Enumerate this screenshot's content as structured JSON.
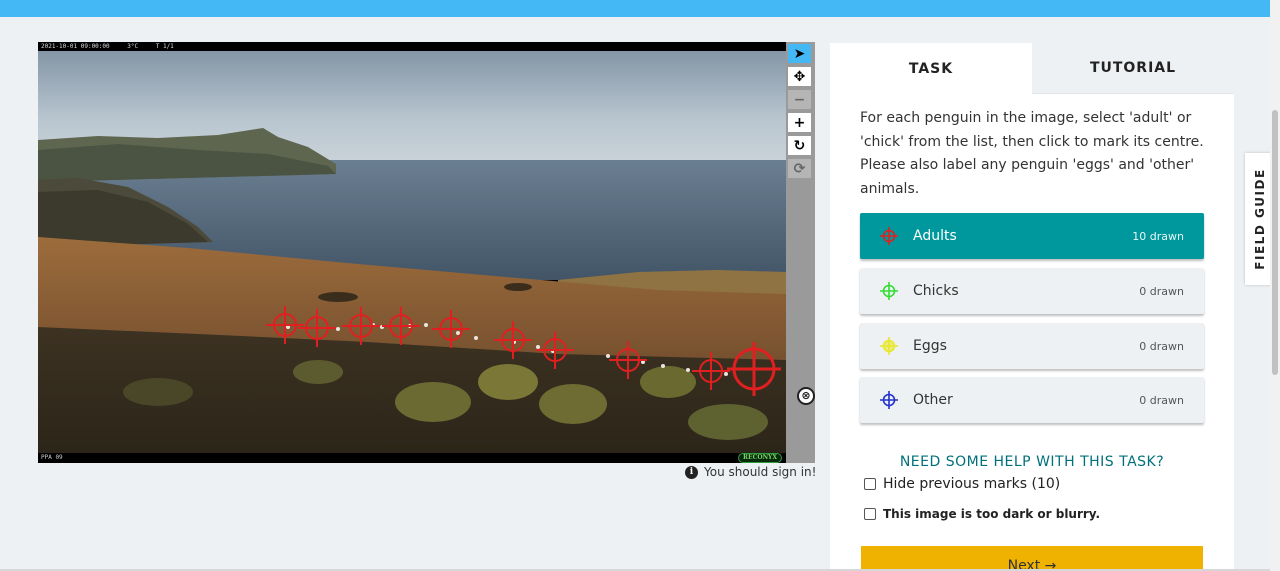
{
  "viewer": {
    "camera_strip": {
      "datetime": "2021-10-01 09:00:00",
      "temperature": "3°C",
      "frame": "T 1/1",
      "site": "PPA 09",
      "brand": "RECONYX"
    },
    "marks_count": 10,
    "delete_glyph": "⊗",
    "tools": [
      {
        "name": "pointer-icon",
        "glyph": "➤"
      },
      {
        "name": "move-icon",
        "glyph": "✥"
      },
      {
        "name": "zoom-out-icon",
        "glyph": "−"
      },
      {
        "name": "zoom-in-icon",
        "glyph": "+"
      },
      {
        "name": "rotate-icon",
        "glyph": "↻"
      },
      {
        "name": "reset-icon",
        "glyph": "⟳"
      }
    ],
    "sign_in_notice": "You should sign in!",
    "info_glyph": "i"
  },
  "panel": {
    "tabs": [
      {
        "label": "TASK",
        "active": true
      },
      {
        "label": "TUTORIAL",
        "active": false
      }
    ],
    "instructions": "For each penguin in the image, select 'adult' or 'chick' from the list, then click to mark its centre. Please also label any penguin 'eggs' and 'other' animals.",
    "tools": [
      {
        "label": "Adults",
        "count": "10 drawn",
        "color": "#e02020",
        "selected": true
      },
      {
        "label": "Chicks",
        "count": "0 drawn",
        "color": "#33dd33",
        "selected": false
      },
      {
        "label": "Eggs",
        "count": "0 drawn",
        "color": "#e8e82a",
        "selected": false
      },
      {
        "label": "Other",
        "count": "0 drawn",
        "color": "#2233cc",
        "selected": false
      }
    ],
    "help_link": "NEED SOME HELP WITH THIS TASK?",
    "hide_marks_label": "Hide previous marks (10)",
    "too_dark_label": "This image is too dark or blurry.",
    "next_label": "Next →"
  },
  "field_guide": {
    "label": "FIELD GUIDE"
  },
  "colors": {
    "topbar": "#43b8f5",
    "selected_tool": "#00979d",
    "next_button": "#f0b200",
    "help_link": "#00707a",
    "mark": "#e02020"
  }
}
